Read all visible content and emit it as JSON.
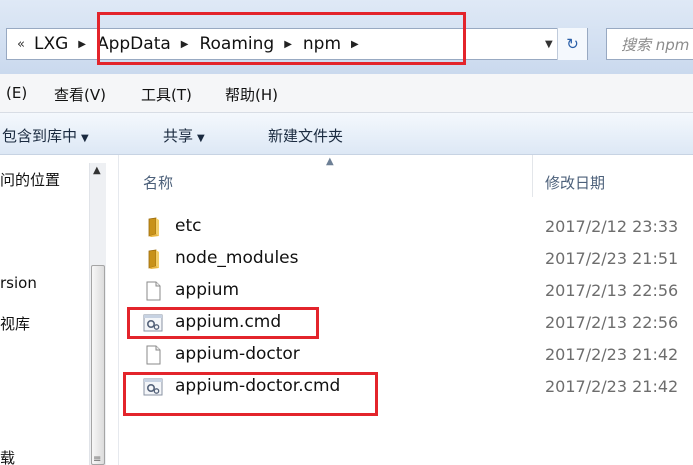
{
  "address_bar": {
    "overflow_chevron": "«",
    "crumbs": [
      "LXG",
      "AppData",
      "Roaming",
      "npm"
    ],
    "search_placeholder": "搜索 npm"
  },
  "menu": {
    "items": [
      "(E)",
      "查看(V)",
      "工具(T)",
      "帮助(H)"
    ]
  },
  "toolbar": {
    "include_in_library": "包含到库中",
    "share": "共享",
    "new_folder": "新建文件夹"
  },
  "nav_pane": {
    "items": [
      "问的位置",
      "rsion",
      "视库",
      "载"
    ]
  },
  "file_list": {
    "columns": {
      "name": "名称",
      "date_modified": "修改日期"
    },
    "rows": [
      {
        "name": "etc",
        "date": "2017/2/12 23:33",
        "icon": "folder-icon"
      },
      {
        "name": "node_modules",
        "date": "2017/2/23 21:51",
        "icon": "folder-icon"
      },
      {
        "name": "appium",
        "date": "2017/2/13 22:56",
        "icon": "file-icon"
      },
      {
        "name": "appium.cmd",
        "date": "2017/2/13 22:56",
        "icon": "cmd-file-icon"
      },
      {
        "name": "appium-doctor",
        "date": "2017/2/23 21:42",
        "icon": "file-icon"
      },
      {
        "name": "appium-doctor.cmd",
        "date": "2017/2/23 21:42",
        "icon": "cmd-file-icon"
      }
    ]
  },
  "colors": {
    "highlight": "#e3242b",
    "address_bg": "#cad9ee",
    "toolbar_text": "#1a2a3f",
    "date_text": "#6d6d6d"
  }
}
